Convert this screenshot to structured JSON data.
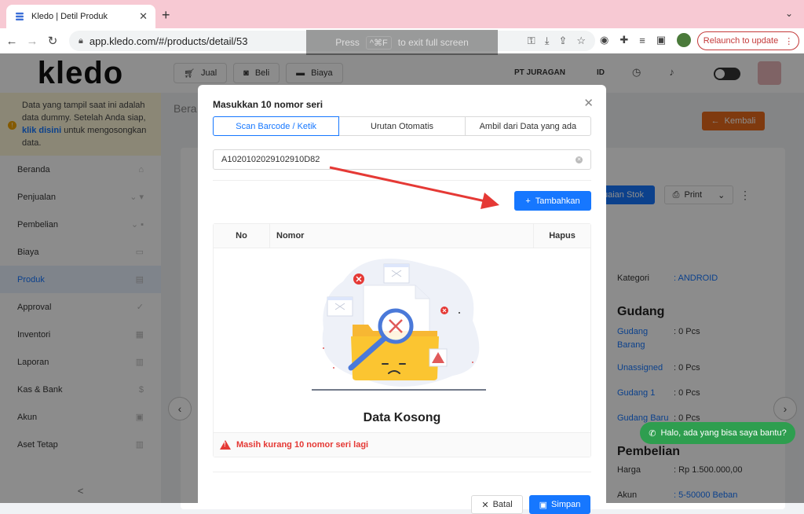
{
  "browser": {
    "tab_title": "Kledo | Detil Produk",
    "tab_close": "✕",
    "new_tab": "+",
    "tab_menu": "⌄",
    "url": "app.kledo.com/#/products/detail/53",
    "fullscreen_hint_prefix": "Press",
    "fullscreen_hint_key": "^⌘F",
    "fullscreen_hint_suffix": "to exit full screen",
    "relaunch_label": "Relaunch to update",
    "relaunch_more": "⋮"
  },
  "sidebar": {
    "logo": "kledo",
    "notice_text": "Data yang tampil saat ini adalah data dummy. Setelah Anda siap,",
    "notice_link": "klik disini",
    "notice_text2": "untuk mengosongkan data.",
    "items": [
      {
        "label": "Beranda"
      },
      {
        "label": "Penjualan"
      },
      {
        "label": "Pembelian"
      },
      {
        "label": "Biaya"
      },
      {
        "label": "Produk"
      },
      {
        "label": "Approval"
      },
      {
        "label": "Inventori"
      },
      {
        "label": "Laporan"
      },
      {
        "label": "Kas & Bank"
      },
      {
        "label": "Akun"
      },
      {
        "label": "Aset Tetap"
      }
    ],
    "collapse": "<"
  },
  "topnav": {
    "jual": "Jual",
    "beli": "Beli",
    "biaya": "Biaya",
    "company": "PT JURAGAN",
    "lang": "ID"
  },
  "page": {
    "breadcrumb": "Bera",
    "kembali": "Kembali",
    "stok_btn": "uaian Stok",
    "print": "Print",
    "kategori_label": "Kategori",
    "kategori_value": ": ANDROID",
    "gudang_title": "Gudang",
    "gudang_rows": [
      {
        "name": "Gudang Barang",
        "value": ": 0 Pcs"
      },
      {
        "name": "Unassigned",
        "value": ": 0 Pcs"
      },
      {
        "name": "Gudang 1",
        "value": ": 0 Pcs"
      },
      {
        "name": "Gudang Baru",
        "value": ": 0 Pcs"
      }
    ],
    "pembelian_title": "Pembelian",
    "harga_label": "Harga",
    "harga_value": ": Rp 1.500.000,00",
    "akun_label": "Akun",
    "akun_value": ": 5-50000 Beban",
    "whatsapp": "Halo, ada yang bisa saya bantu?"
  },
  "modal": {
    "title": "Masukkan 10 nomor seri",
    "close": "✕",
    "tabs": [
      "Scan Barcode / Ketik",
      "Urutan Otomatis",
      "Ambil dari Data yang ada"
    ],
    "serial_value": "A1020102029102910D82",
    "add_button": "Tambahkan",
    "columns": {
      "no": "No",
      "nomor": "Nomor",
      "hapus": "Hapus"
    },
    "empty_text": "Data Kosong",
    "warning": "Masih kurang 10 nomor seri lagi",
    "batal": "Batal",
    "simpan": "Simpan"
  },
  "colors": {
    "primary": "#1677ff",
    "danger": "#e53935",
    "accent_orange": "#e86a1c",
    "folder_yellow": "#fbc531",
    "whatsapp_green": "#2e9e4f",
    "tab_strip": "#f7c9d3"
  }
}
